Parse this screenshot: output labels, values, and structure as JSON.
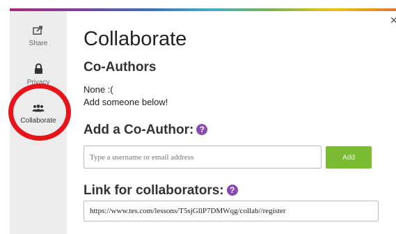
{
  "sidebar": {
    "items": [
      {
        "label": "Share",
        "icon": "share-icon"
      },
      {
        "label": "Privacy",
        "icon": "lock-icon"
      },
      {
        "label": "Collaborate",
        "icon": "users-icon"
      }
    ]
  },
  "header": {
    "title": "Collaborate",
    "close_icon": "close-icon"
  },
  "coauthors": {
    "heading": "Co-Authors",
    "empty_line1": "None :(",
    "empty_line2": "Add someone below!"
  },
  "add_coauthor": {
    "heading": "Add a Co-Author:",
    "help": "?",
    "input_placeholder": "Type a username or email address",
    "button_label": "Add"
  },
  "link_section": {
    "heading": "Link for collaborators:",
    "help": "?",
    "url": "https://www.tes.com/lessons/T5sjGllP7DMWqg/collab//register"
  },
  "colors": {
    "accent_green": "#7cbc35",
    "help_purple": "#8a4bb0",
    "highlight_red": "#e8141c",
    "sidebar_bg": "#ececec"
  }
}
